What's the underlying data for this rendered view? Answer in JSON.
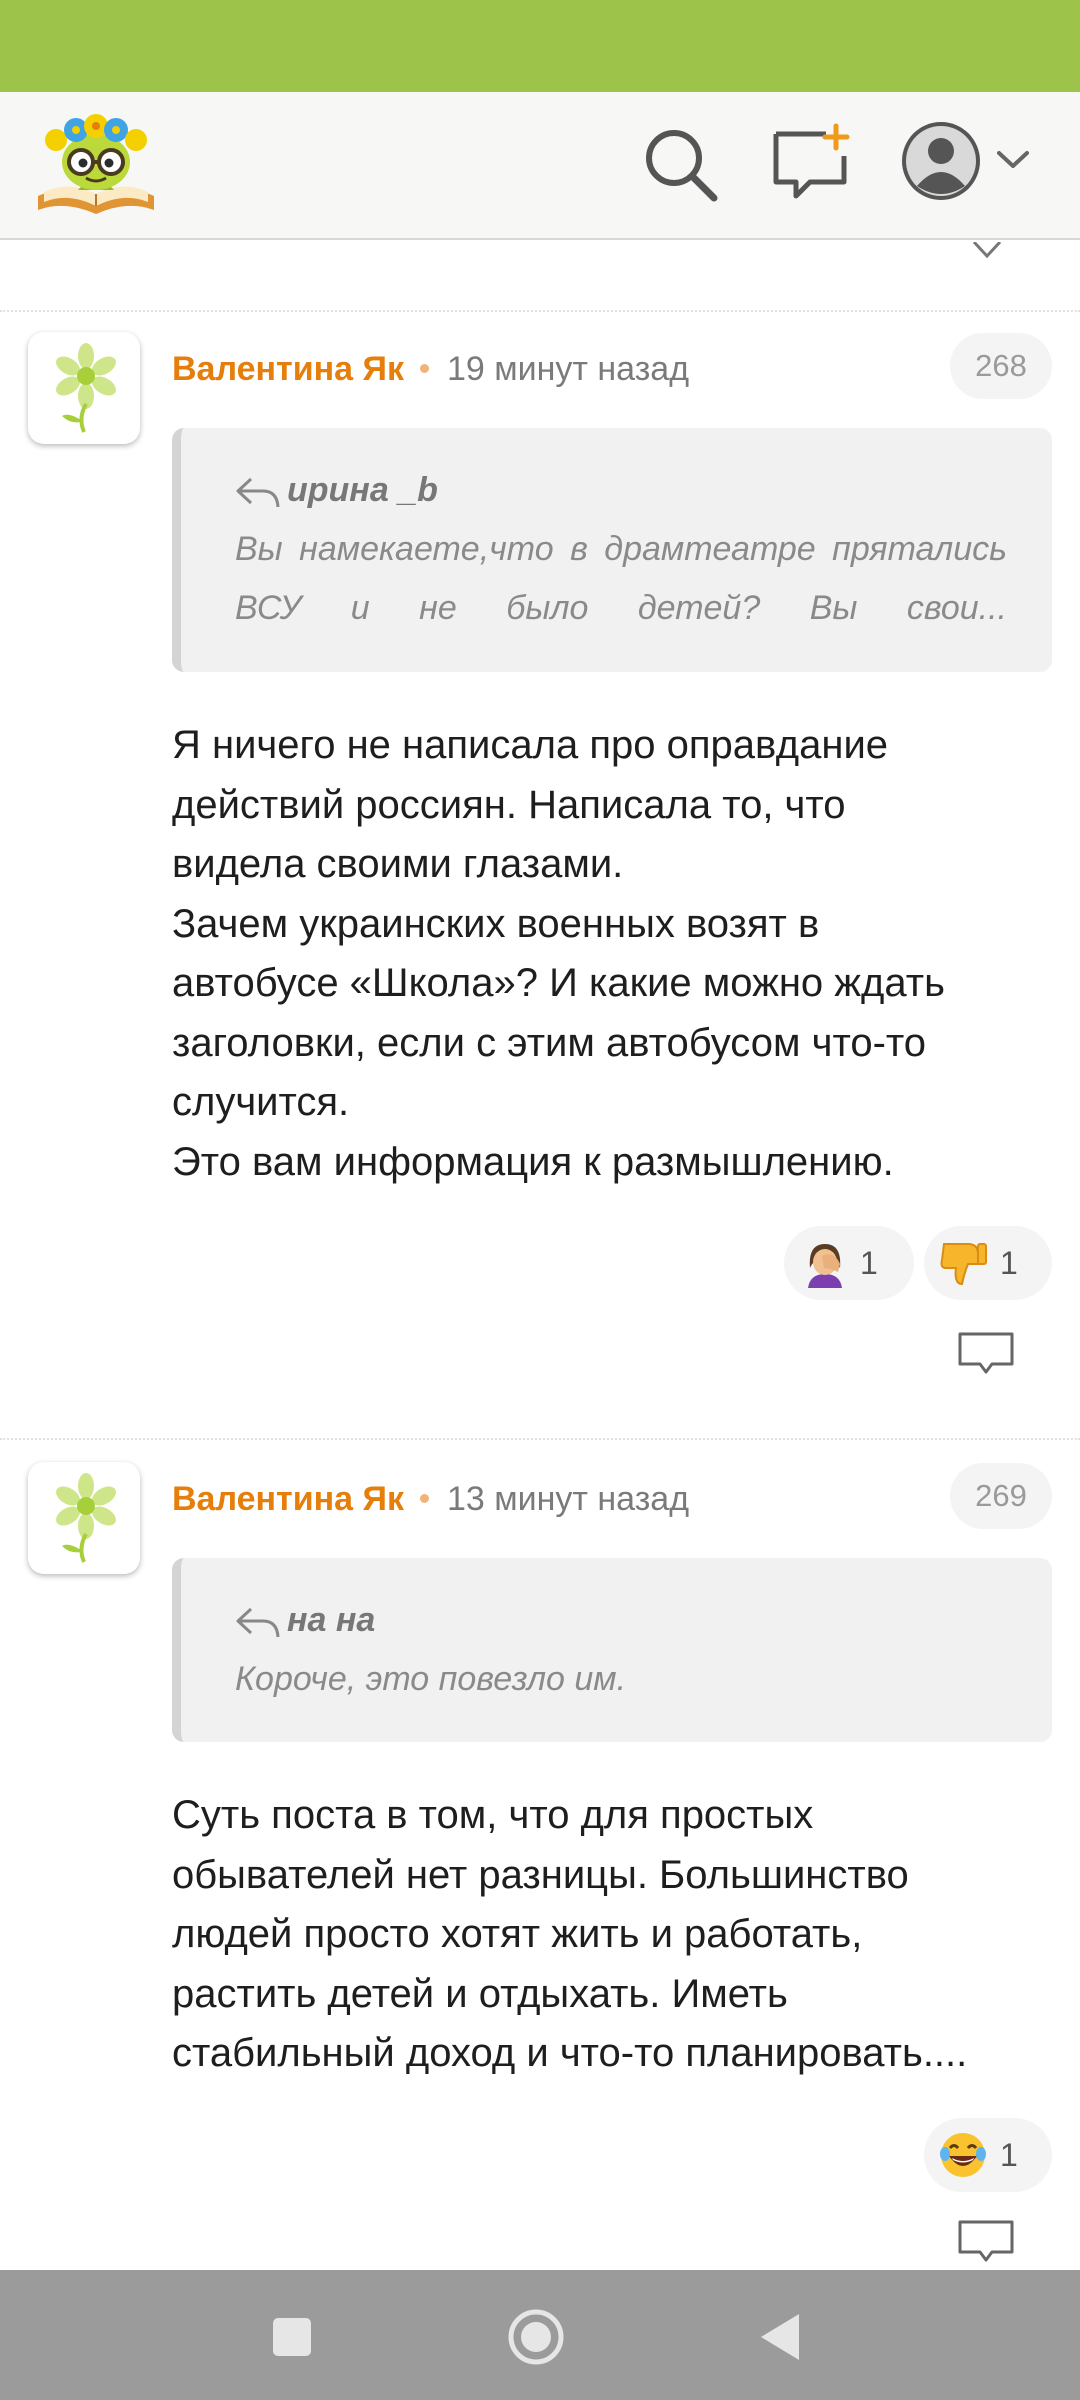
{
  "header": {
    "logo": "smiling-book-flower-glasses-logo",
    "search_icon": "search-icon",
    "new_post_icon": "new-comment-plus-icon",
    "profile_icon": "user-avatar-icon",
    "menu_icon": "chevron-down-icon"
  },
  "colors": {
    "status_bar": "#9dc34a",
    "author": "#e67e0b",
    "navbar": "#9b9b9b"
  },
  "comments": [
    {
      "author": "Валентина Як",
      "time": "19 минут назад",
      "number": "268",
      "quote_author": "ирина _b",
      "quote_lines": [
        "Вы намекаете,что в драмтеатре прятались",
        "ВСУ и не было детей? Вы свои..."
      ],
      "body_lines": [
        "Я ничего не написала про оправдание",
        "действий россиян. Написала то, что",
        "видела своими глазами.",
        "Зачем украинских военных возят в",
        "автобусе «Школа»? И какие можно ждать",
        "заголовки, если с этим автобусом что-то",
        "случится.",
        "Это вам информация к размышлению."
      ],
      "reactions": [
        {
          "emoji": "facepalm-emoji",
          "count": "1"
        },
        {
          "emoji": "thumbs-down-emoji",
          "count": "1"
        }
      ]
    },
    {
      "author": "Валентина Як",
      "time": "13 минут назад",
      "number": "269",
      "quote_author": "на на",
      "quote_lines": [
        "Короче, это повезло им."
      ],
      "body_lines": [
        "Суть поста в том, что для простых",
        "обывателей нет разницы. Большинство",
        "людей просто хотят жить и работать,",
        "растить детей и отдыхать. Иметь",
        "стабильный доход и что-то планировать...."
      ],
      "reactions": [
        {
          "emoji": "tears-of-joy-emoji",
          "count": "1"
        }
      ]
    }
  ],
  "navbar": {
    "recents": "recents-square-icon",
    "home": "home-circle-icon",
    "back": "back-triangle-icon"
  }
}
